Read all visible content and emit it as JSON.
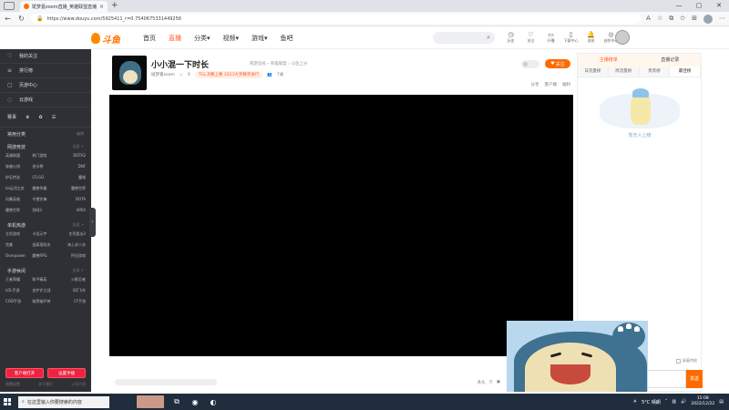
{
  "browser": {
    "tab_title": "斑梦嘉zoom直播_英雄联盟直播",
    "tab_close": "×",
    "new_tab": "+",
    "url": "https://www.douyu.com/5925411_r=0.7540675331449256",
    "window_controls": [
      "—",
      "▢",
      "✕"
    ]
  },
  "site": {
    "logo_text": "斗鱼",
    "nav": [
      {
        "label": "首页",
        "active": false
      },
      {
        "label": "直播",
        "active": true
      },
      {
        "label": "分类▾",
        "active": false
      },
      {
        "label": "视频▾",
        "active": false
      },
      {
        "label": "游戏▾",
        "active": false
      },
      {
        "label": "鱼吧",
        "active": false
      }
    ],
    "header_tools": [
      "历史",
      "关注",
      "开播",
      "下载中心",
      "消息",
      "创作中心"
    ]
  },
  "sidebar": {
    "top_items": [
      {
        "icon": "♡",
        "label": "我的关注"
      },
      {
        "icon": "≡",
        "label": "排行榜"
      },
      {
        "icon": "▢",
        "label": "页游中心"
      },
      {
        "icon": "◌",
        "label": "云游戏"
      }
    ],
    "icon_row": [
      "赛事",
      "♛",
      "✿",
      "☰"
    ],
    "common_label": "常用分类",
    "common_more": "编辑",
    "sections": [
      {
        "title": "网游竞技",
        "more": "全部 >",
        "items": [
          "英雄联盟",
          "热门游戏",
          "DOTA2",
          "穿越火线",
          "逆水寒",
          "DNF",
          "炉石传说",
          "CS:GO",
          "魔域",
          "lol云顶之弈",
          "魔兽争霸",
          "魔兽世界",
          "风暴英雄",
          "守望先锋",
          "DOTA",
          "魔兽世界",
          "剑网3",
          "APEX"
        ]
      },
      {
        "title": "单机热游",
        "more": "全部 >",
        "items": [
          "主机游戏",
          "卡坦元宇",
          "生死狙击2",
          "完美",
          "逃离塔科夫",
          "海上求人亦",
          "Overpower",
          "魔兽RPG",
          "怀旧游戏"
        ]
      },
      {
        "title": "手游休闲",
        "more": "全部 >",
        "items": [
          "王者荣耀",
          "和平精英",
          "火影忍者",
          "LOL手游",
          "金铲铲之战",
          "QQ飞车",
          "COD手游",
          "暗黑破坏神",
          "CF手游"
        ]
      }
    ],
    "bottom_buttons": [
      "客户端打开",
      "设置手播"
    ],
    "footer": [
      "直播设置",
      "关于我们",
      "公司介绍"
    ]
  },
  "room": {
    "title": "小小混一下时长",
    "category": "网游竞技 › 英雄联盟 › 斗鱼上分",
    "streamer": "斑梦嘉zoom",
    "hot": "0",
    "tag": "TGL决赛上赛 2023大奖赛奖进行",
    "viewers": "7关",
    "follow_label": "关注",
    "actions": [
      "分享",
      "客户端",
      "福利"
    ]
  },
  "below_player": {
    "tools": [
      "条头",
      "◷",
      "▣"
    ]
  },
  "right_panel": {
    "tabs": [
      {
        "label": "主播榜单",
        "active": true
      },
      {
        "label": "直播记录",
        "active": false
      }
    ],
    "sub_tabs": [
      {
        "label": "日流量榜",
        "active": false
      },
      {
        "label": "周流量榜",
        "active": false
      },
      {
        "label": "贵宾榜",
        "active": false
      },
      {
        "label": "最佳榜",
        "active": true
      }
    ],
    "empty_text": "暂无人上榜",
    "checkbox_label": "屏蔽特效",
    "send_label": "发送"
  },
  "taskbar": {
    "search_placeholder": "在这里输入你要搜索的内容",
    "weather": "5°C 晴朗",
    "time": "15:08",
    "date": "2022/12/22"
  }
}
